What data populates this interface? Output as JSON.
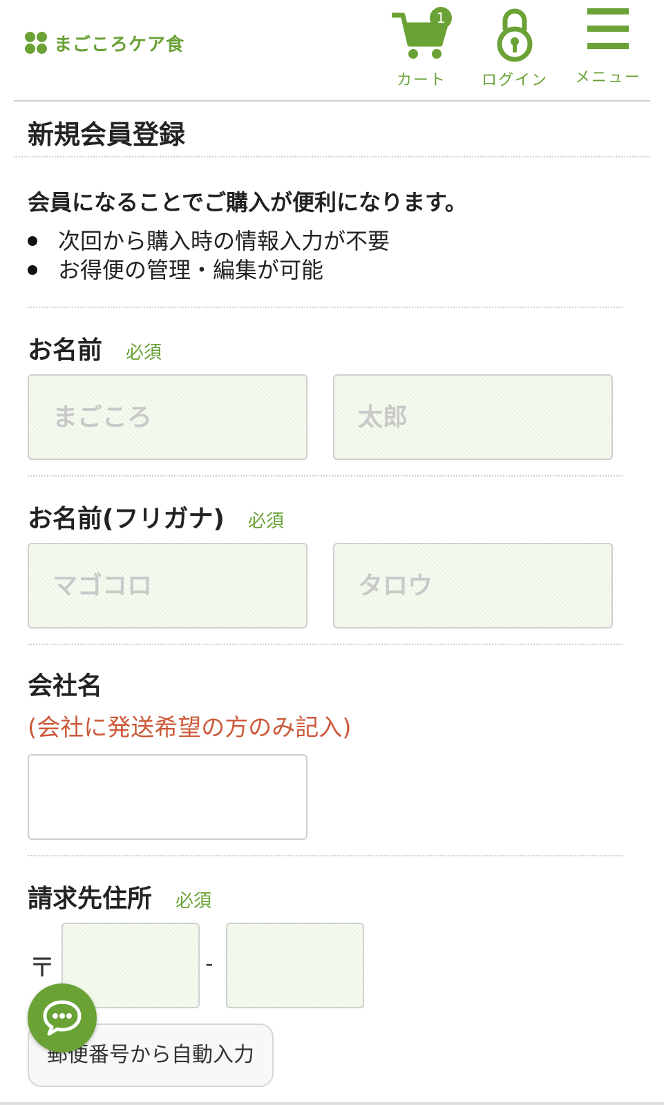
{
  "header": {
    "logo_text": "まごころケア食",
    "cart": {
      "label": "カート",
      "count": "1"
    },
    "login": {
      "label": "ログイン"
    },
    "menu": {
      "label": "メニュー"
    }
  },
  "page_title": "新規会員登録",
  "intro": {
    "lead": "会員になることでご購入が便利になります。",
    "benefits": [
      "次回から購入時の情報入力が不要",
      "お得便の管理・編集が可能"
    ]
  },
  "form": {
    "name": {
      "label": "お名前",
      "required": "必須",
      "last_placeholder": "まごころ",
      "first_placeholder": "太郎"
    },
    "kana": {
      "label": "お名前(フリガナ)",
      "required": "必須",
      "last_placeholder": "マゴコロ",
      "first_placeholder": "タロウ"
    },
    "company": {
      "label": "会社名",
      "note": "(会社に発送希望の方のみ記入)"
    },
    "address": {
      "label": "請求先住所",
      "required": "必須",
      "postal_mark": "〒",
      "dash": "-",
      "auto_fill_button": "郵便番号から自動入力"
    }
  },
  "colors": {
    "accent": "#6aa236",
    "note": "#cc5a3a",
    "field_bg": "#eef7e7"
  }
}
